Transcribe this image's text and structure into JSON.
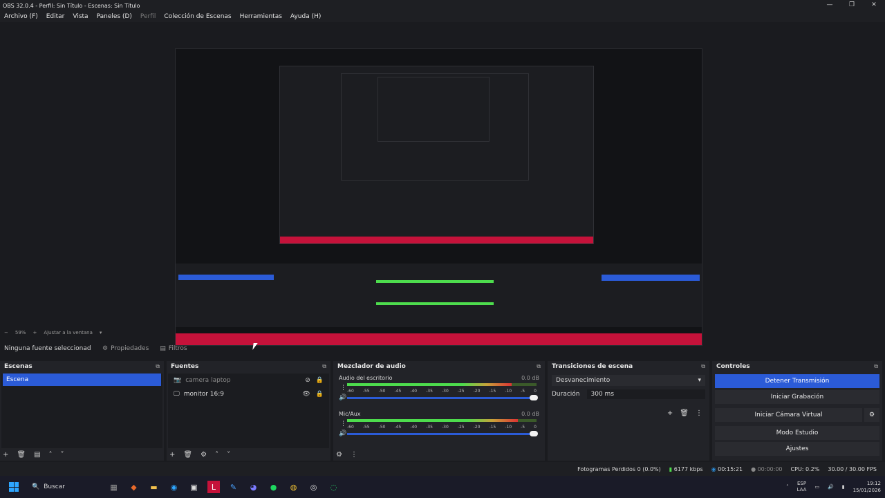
{
  "window": {
    "title": "OBS 32.0.4 - Perfil: Sin Título - Escenas: Sin Título",
    "controls": [
      "—",
      "❐",
      "✕"
    ]
  },
  "menu": [
    "Archivo (F)",
    "Editar",
    "Vista",
    "Paneles (D)",
    "Perfil",
    "Colección de Escenas",
    "Herramientas",
    "Ayuda (H)"
  ],
  "zoom": {
    "percent": "59%",
    "fit_label": "Ajustar a la ventana"
  },
  "source_toolbar": {
    "no_source": "Ninguna fuente seleccionad",
    "properties": "Propiedades",
    "filters": "Filtros"
  },
  "scenes": {
    "title": "Escenas",
    "items": [
      "Escena"
    ]
  },
  "sources": {
    "title": "Fuentes",
    "items": [
      {
        "name": "camera laptop",
        "visible": false
      },
      {
        "name": "monitor 16:9",
        "visible": true
      }
    ]
  },
  "mixer": {
    "title": "Mezclador de audio",
    "tracks": [
      {
        "name": "Audio del escritorio",
        "db": "0.0 dB",
        "level": 0.87
      },
      {
        "name": "Mic/Aux",
        "db": "0.0 dB",
        "level": 0.9
      }
    ],
    "ticks": [
      "-60",
      "-55",
      "-50",
      "-45",
      "-40",
      "-35",
      "-30",
      "-25",
      "-20",
      "-15",
      "-10",
      "-5",
      "0"
    ]
  },
  "transitions": {
    "title": "Transiciones de escena",
    "selected": "Desvanecimiento",
    "duration_label": "Duración",
    "duration_value": "300 ms"
  },
  "controls": {
    "title": "Controles",
    "buttons": [
      "Detener Transmisión",
      "Iniciar Grabación",
      "Iniciar Cámara Virtual",
      "Modo Estudio",
      "Ajustes"
    ]
  },
  "status": {
    "dropped": "Fotogramas Perdidos 0 (0.0%)",
    "kbps": "6177 kbps",
    "stream_time": "00:15:21",
    "rec_time": "00:00:00",
    "cpu": "CPU: 0.2%",
    "fps": "30.00 / 30.00 FPS"
  },
  "taskbar": {
    "search": "Buscar",
    "lang": "ESP",
    "lang2": "LAA",
    "time": "19:12",
    "date": "15/01/2026"
  },
  "colors": {
    "accent": "#2b5bd7",
    "taskbar": "#1a1b28"
  }
}
